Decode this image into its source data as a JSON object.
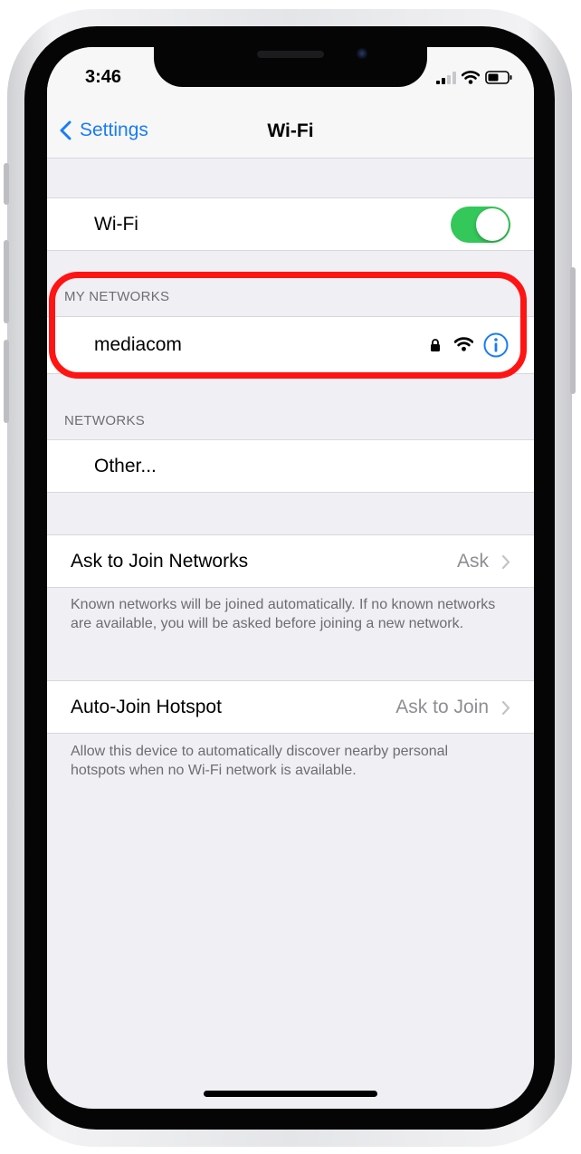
{
  "status_bar": {
    "time": "3:46"
  },
  "navbar": {
    "back_label": "Settings",
    "title": "Wi-Fi"
  },
  "wifi_row": {
    "label": "Wi-Fi",
    "enabled": true
  },
  "my_networks": {
    "header": "MY NETWORKS",
    "items": [
      {
        "name": "mediacom",
        "secured": true
      }
    ]
  },
  "networks": {
    "header": "NETWORKS",
    "items": [
      {
        "name": "Other..."
      }
    ]
  },
  "ask_to_join": {
    "label": "Ask to Join Networks",
    "value": "Ask",
    "footer": "Known networks will be joined automatically. If no known networks are available, you will be asked before joining a new network."
  },
  "auto_join_hotspot": {
    "label": "Auto-Join Hotspot",
    "value": "Ask to Join",
    "footer": "Allow this device to automatically discover nearby personal hotspots when no Wi-Fi network is available."
  },
  "colors": {
    "accent": "#1a7cf5",
    "toggle_on": "#34c759",
    "highlight": "#ff1414",
    "group_bg": "#efeff4"
  },
  "icons": [
    "chevron-left-icon",
    "lock-icon",
    "wifi-icon",
    "info-icon",
    "chevron-right-icon",
    "cellular-signal-icon",
    "battery-icon"
  ]
}
